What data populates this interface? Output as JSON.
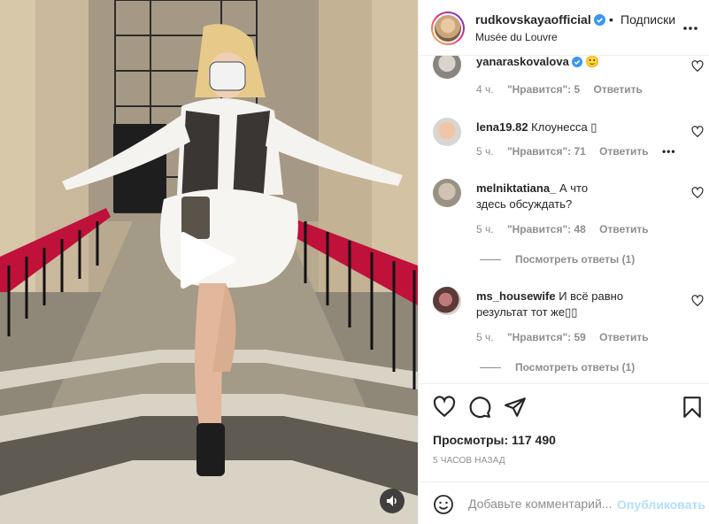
{
  "header": {
    "username": "rudkovskayaofficial",
    "separator": "•",
    "follow_label": "Подписки",
    "location": "Musée du Louvre",
    "more_icon": "more-horizontal-icon"
  },
  "comments": [
    {
      "username": "yanaraskovalova",
      "text": "🙂",
      "verified": true,
      "time": "4 ч.",
      "likes": "\"Нравится\": 5",
      "reply": "Ответить"
    },
    {
      "username": "lena19.82",
      "text": "Клоунесса ▯",
      "verified": false,
      "time": "5 ч.",
      "likes": "\"Нравится\": 71",
      "reply": "Ответить",
      "more": "•••"
    },
    {
      "username": "melniktatiana_",
      "text": "А что здесь обсуждать?",
      "verified": false,
      "time": "5 ч.",
      "likes": "\"Нравится\": 48",
      "reply": "Ответить",
      "view_replies": "Посмотреть ответы (1)"
    },
    {
      "username": "ms_housewife",
      "text": "И всё равно результат тот же▯▯",
      "verified": false,
      "time": "5 ч.",
      "likes": "\"Нравится\": 59",
      "reply": "Ответить",
      "view_replies": "Посмотреть ответы (1)"
    }
  ],
  "stats": {
    "views": "Просмотры: 117 490",
    "time_ago": "5 ЧАСОВ НАЗАД"
  },
  "composer": {
    "placeholder": "Добавьте комментарий...",
    "publish_label": "Опубликовать"
  },
  "colors": {
    "verified_blue": "#3897f0",
    "publish_disabled": "#b2dffc",
    "secondary_text": "#8e8e8e",
    "primary_text": "#262626",
    "border": "#efefef"
  },
  "icons": {
    "play": "play-icon",
    "sound": "sound-icon",
    "like": "heart-icon",
    "comment": "comment-icon",
    "share": "share-icon",
    "save": "bookmark-icon",
    "emoji": "emoji-icon"
  }
}
